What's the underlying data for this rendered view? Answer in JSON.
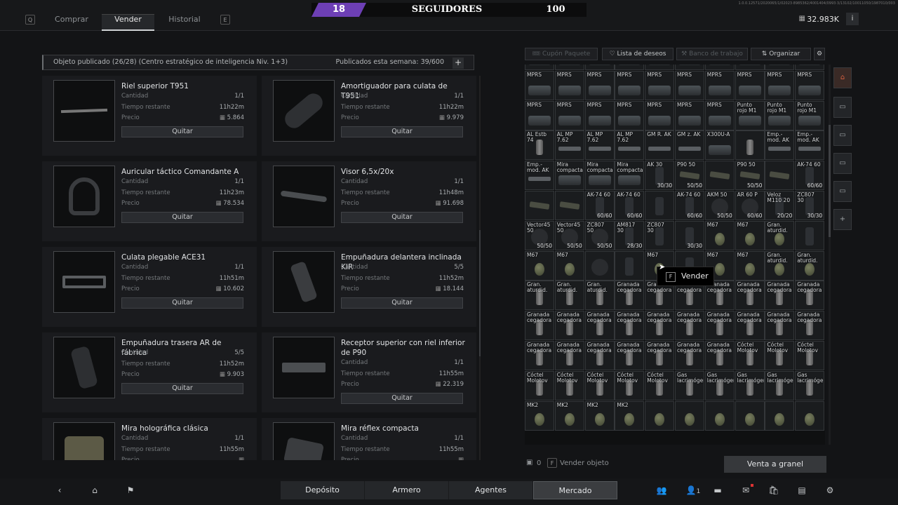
{
  "header": {
    "key_left": "Q",
    "key_right": "E",
    "tabs": [
      {
        "label": "Comprar"
      },
      {
        "label": "Vender"
      },
      {
        "label": "Historial"
      }
    ],
    "level": "18",
    "followers_label": "SEGUIDORES",
    "followers_value": "100",
    "money": "32.983K",
    "info": "i",
    "version": "1.0.0.12571/2020065/1/02023·8985362/4001404/0993·3/13102/10011050/1987010/003"
  },
  "listing_bar": {
    "left": "Objeto publicado  (26/28)  (Centro estratégico de inteligencia Niv. 1+3)",
    "right": "Publicados esta semana: 39/600",
    "plus": "+"
  },
  "row_labels": {
    "qty": "Cantidad",
    "time": "Tiempo restante",
    "price": "Precio",
    "remove": "Quitar"
  },
  "listings": [
    {
      "name": "Riel superior T951",
      "qty": "1/1",
      "time": "11h22m",
      "price": "5.864",
      "art": "rail"
    },
    {
      "name": "Amortiguador para culata de T951",
      "qty": "1/1",
      "time": "11h22m",
      "price": "9.979",
      "art": "pad"
    },
    {
      "name": "Auricular táctico Comandante A",
      "qty": "1/1",
      "time": "11h23m",
      "price": "78.534",
      "art": "headset"
    },
    {
      "name": "Visor 6,5x/20x",
      "qty": "1/1",
      "time": "11h48m",
      "price": "91.698",
      "art": "scope"
    },
    {
      "name": "Culata plegable ACE31",
      "qty": "1/1",
      "time": "11h51m",
      "price": "10.602",
      "art": "stock"
    },
    {
      "name": "Empuñadura delantera inclinada KIR",
      "qty": "5/5",
      "time": "11h52m",
      "price": "18.144",
      "art": "grip"
    },
    {
      "name": "Empuñadura trasera AR de fábrica",
      "qty": "5/5",
      "time": "11h52m",
      "price": "9.903",
      "art": "grip2"
    },
    {
      "name": "Receptor superior con riel inferior de P90",
      "qty": "1/1",
      "time": "11h55m",
      "price": "22.319",
      "art": "receiver"
    },
    {
      "name": "Mira holográfica clásica",
      "qty": "1/1",
      "time": "11h55m",
      "price": "",
      "art": "holo"
    },
    {
      "name": "Mira réflex compacta",
      "qty": "1/1",
      "time": "11h55m",
      "price": "",
      "art": "reflex"
    }
  ],
  "inventory_toolbar": {
    "coupon": "Cupón Paquete",
    "wishlist": "Lista de deseos",
    "workbench": "Banco de trabajo",
    "organize": "Organizar"
  },
  "inventory": {
    "rows": [
      [
        {
          "l": "",
          "a": "scope"
        },
        {
          "l": "",
          "a": "scope"
        },
        {
          "l": "",
          "a": "scope"
        },
        {
          "l": "",
          "a": "scope"
        },
        {
          "l": "",
          "a": "scope"
        },
        {
          "l": "",
          "a": "scope"
        },
        {
          "l": "",
          "a": "scope"
        },
        {
          "l": "",
          "a": "scope"
        },
        {
          "l": "",
          "a": "scope"
        },
        {
          "l": "",
          "a": "scope"
        }
      ],
      [
        {
          "l": "MPRS",
          "a": "scope"
        },
        {
          "l": "MPRS",
          "a": "scope"
        },
        {
          "l": "MPRS",
          "a": "scope"
        },
        {
          "l": "MPRS",
          "a": "scope"
        },
        {
          "l": "MPRS",
          "a": "scope"
        },
        {
          "l": "MPRS",
          "a": "scope"
        },
        {
          "l": "MPRS",
          "a": "scope"
        },
        {
          "l": "MPRS",
          "a": "scope"
        },
        {
          "l": "MPRS",
          "a": "scope"
        },
        {
          "l": "MPRS",
          "a": "scope"
        }
      ],
      [
        {
          "l": "MPRS",
          "a": "scope"
        },
        {
          "l": "MPRS",
          "a": "scope"
        },
        {
          "l": "MPRS",
          "a": "scope"
        },
        {
          "l": "MPRS",
          "a": "scope"
        },
        {
          "l": "MPRS",
          "a": "scope"
        },
        {
          "l": "MPRS",
          "a": "scope"
        },
        {
          "l": "MPRS",
          "a": "scope"
        },
        {
          "l": "Punto rojo M1",
          "a": "scope"
        },
        {
          "l": "Punto rojo M1",
          "a": "scope"
        },
        {
          "l": "Punto rojo M1",
          "a": "scope"
        }
      ],
      [
        {
          "l": "AL Estb 74",
          "a": "can"
        },
        {
          "l": "AL MP 7.62",
          "a": "rail"
        },
        {
          "l": "AL MP 7.62",
          "a": "rail"
        },
        {
          "l": "AL MP 7.62",
          "a": "rail"
        },
        {
          "l": "GM R. AK",
          "a": "rail"
        },
        {
          "l": "GM z. AK",
          "a": "rail"
        },
        {
          "l": "X300U-A",
          "a": "scope"
        },
        {
          "l": "",
          "a": "can"
        },
        {
          "l": "Emp.-mod. AK",
          "a": "rail"
        },
        {
          "l": "Emp.-mod. AK",
          "a": "rail"
        }
      ],
      [
        {
          "l": "Emp.-mod. AK",
          "a": "rail"
        },
        {
          "l": "Mira compacta",
          "a": "scope"
        },
        {
          "l": "Mira compacta",
          "a": "scope"
        },
        {
          "l": "Mira compacta",
          "a": "scope"
        },
        {
          "l": "AK 30",
          "a": "mag",
          "c": "30/30"
        },
        {
          "l": "P90 50",
          "a": "long",
          "c": "50/50"
        },
        {
          "l": "",
          "a": "long"
        },
        {
          "l": "P90 50",
          "a": "long",
          "c": "50/50"
        },
        {
          "l": "",
          "a": "long"
        },
        {
          "l": "AK-74 60",
          "a": "mag",
          "c": "60/60"
        }
      ],
      [
        {
          "l": "",
          "a": "long"
        },
        {
          "l": "",
          "a": "long"
        },
        {
          "l": "AK-74 60",
          "a": "mag",
          "c": "60/60"
        },
        {
          "l": "AK-74 60",
          "a": "mag",
          "c": "60/60"
        },
        {
          "l": "",
          "a": "mag"
        },
        {
          "l": "AK-74 60",
          "a": "mag",
          "c": "60/60"
        },
        {
          "l": "AKM 50",
          "a": "drum",
          "c": "50/50"
        },
        {
          "l": "AR 60 P",
          "a": "drum",
          "c": "60/60"
        },
        {
          "l": "Veloz M110 20",
          "a": "mag",
          "c": "20/20"
        },
        {
          "l": "ZC807 30",
          "a": "mag",
          "c": "30/30"
        }
      ],
      [
        {
          "l": "Vector45 50",
          "a": "drum",
          "c": "50/50"
        },
        {
          "l": "Vector45 50",
          "a": "drum",
          "c": "50/50"
        },
        {
          "l": "ZC807 50",
          "a": "drum",
          "c": "50/50"
        },
        {
          "l": "AM817 30",
          "a": "mag",
          "c": "28/30"
        },
        {
          "l": "ZC807 30",
          "a": "mag"
        },
        {
          "l": "",
          "a": "mag",
          "c": "30/30"
        },
        {
          "l": "M67",
          "a": "nade"
        },
        {
          "l": "M67",
          "a": "nade"
        },
        {
          "l": "Gran. aturdid.",
          "a": "nade"
        },
        {
          "l": "",
          "a": "mag"
        }
      ],
      [
        {
          "l": "M67",
          "a": "nade"
        },
        {
          "l": "M67",
          "a": "nade"
        },
        {
          "l": "",
          "a": "drum"
        },
        {
          "l": "",
          "a": "mag"
        },
        {
          "l": "M67",
          "a": "nade"
        },
        {
          "l": "",
          "a": "mag"
        },
        {
          "l": "M67",
          "a": "nade"
        },
        {
          "l": "M67",
          "a": "nade"
        },
        {
          "l": "Gran. aturdid.",
          "a": "nade"
        },
        {
          "l": "Gran. aturdid.",
          "a": "nade"
        }
      ],
      [
        {
          "l": "Gran. aturdid.",
          "a": "can"
        },
        {
          "l": "Gran. aturdid.",
          "a": "can"
        },
        {
          "l": "Gran. aturdid.",
          "a": "can"
        },
        {
          "l": "Granada cegadora",
          "a": "can"
        },
        {
          "l": "Granada cegadora",
          "a": "can"
        },
        {
          "l": "Granada cegadora",
          "a": "can"
        },
        {
          "l": "Granada cegadora",
          "a": "can"
        },
        {
          "l": "Granada cegadora",
          "a": "can"
        },
        {
          "l": "Granada cegadora",
          "a": "can"
        },
        {
          "l": "Granada cegadora",
          "a": "can"
        }
      ],
      [
        {
          "l": "Granada cegadora",
          "a": "can"
        },
        {
          "l": "Granada cegadora",
          "a": "can"
        },
        {
          "l": "Granada cegadora",
          "a": "can"
        },
        {
          "l": "Granada cegadora",
          "a": "can"
        },
        {
          "l": "Granada cegadora",
          "a": "can"
        },
        {
          "l": "Granada cegadora",
          "a": "can"
        },
        {
          "l": "Granada cegadora",
          "a": "can"
        },
        {
          "l": "Granada cegadora",
          "a": "can"
        },
        {
          "l": "Granada cegadora",
          "a": "can"
        },
        {
          "l": "Granada cegadora",
          "a": "can"
        }
      ],
      [
        {
          "l": "Granada cegadora",
          "a": "can"
        },
        {
          "l": "Granada cegadora",
          "a": "can"
        },
        {
          "l": "Granada cegadora",
          "a": "can"
        },
        {
          "l": "Granada cegadora",
          "a": "can"
        },
        {
          "l": "Granada cegadora",
          "a": "can"
        },
        {
          "l": "Granada cegadora",
          "a": "can"
        },
        {
          "l": "Granada cegadora",
          "a": "can"
        },
        {
          "l": "Cóctel Molotov",
          "a": "can"
        },
        {
          "l": "Cóctel Molotov",
          "a": "can"
        },
        {
          "l": "Cóctel Molotov",
          "a": "can"
        }
      ],
      [
        {
          "l": "Cóctel Molotov",
          "a": "can"
        },
        {
          "l": "Cóctel Molotov",
          "a": "can"
        },
        {
          "l": "Cóctel Molotov",
          "a": "can"
        },
        {
          "l": "Cóctel Molotov",
          "a": "can"
        },
        {
          "l": "Cóctel Molotov",
          "a": "can"
        },
        {
          "l": "Gas lacrimógeno",
          "a": "can"
        },
        {
          "l": "Gas lacrimógeno",
          "a": "can"
        },
        {
          "l": "Gas lacrimógeno",
          "a": "can"
        },
        {
          "l": "Gas lacrimógeno",
          "a": "can"
        },
        {
          "l": "Gas lacrimógeno",
          "a": "can"
        }
      ],
      [
        {
          "l": "MK2",
          "a": "nade"
        },
        {
          "l": "MK2",
          "a": "nade"
        },
        {
          "l": "MK2",
          "a": "nade"
        },
        {
          "l": "MK2",
          "a": "nade"
        },
        {
          "l": "",
          "a": "nade"
        },
        {
          "l": "",
          "a": "nade"
        },
        {
          "l": "",
          "a": "nade"
        },
        {
          "l": "",
          "a": "nade"
        },
        {
          "l": "",
          "a": "nade"
        },
        {
          "l": "",
          "a": "nade"
        }
      ]
    ]
  },
  "tooltip": {
    "key": "F",
    "label": "Vender"
  },
  "inventory_footer": {
    "count": "0",
    "key": "F",
    "sell_label": "Vender objeto",
    "bulk": "Venta a granel"
  },
  "bottom_nav": {
    "tabs": [
      {
        "label": "Depósito"
      },
      {
        "label": "Armero"
      },
      {
        "label": "Agentes"
      },
      {
        "label": "Mercado"
      }
    ],
    "active": "Mercado",
    "friends_count": "1"
  },
  "colors": {
    "accent_level": "#6d3fb5",
    "background": "#131416",
    "warning": "#d7603f"
  }
}
